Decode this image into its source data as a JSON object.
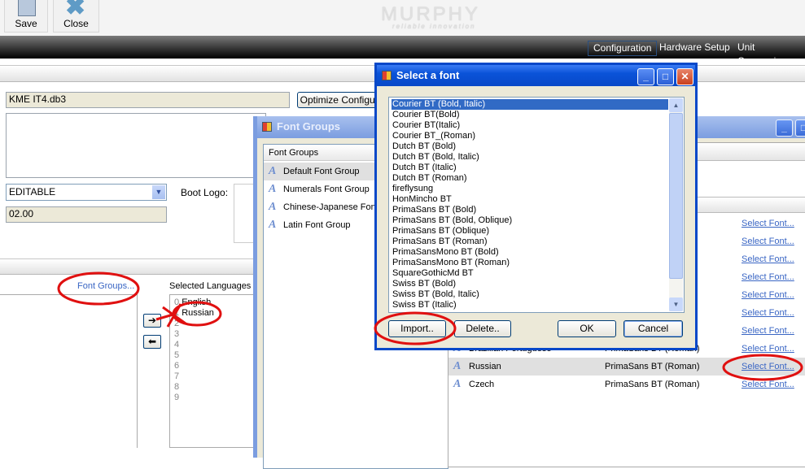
{
  "toolbar": {
    "save_label": "Save",
    "close_label": "Close",
    "logo_text": "MURPHY",
    "logo_tagline": "reliable innovation"
  },
  "nav": {
    "tabs": [
      {
        "label": "Configuration",
        "active": true
      },
      {
        "label": "Hardware Setup"
      },
      {
        "label": "Unit Conversion"
      }
    ]
  },
  "form": {
    "filename": "KME IT4.db3",
    "optimize_label": "Optimize Configura",
    "mode_value": "EDITABLE",
    "version_value": "02.00",
    "boot_logo_label": "Boot Logo:"
  },
  "languages": {
    "font_groups_link": "Font Groups...",
    "selected_label": "Selected Languages",
    "items": [
      {
        "index": "0",
        "name": "English"
      },
      {
        "index": "1",
        "name": "Russian"
      },
      {
        "index": "2",
        "name": ""
      },
      {
        "index": "3",
        "name": ""
      },
      {
        "index": "4",
        "name": ""
      },
      {
        "index": "5",
        "name": ""
      },
      {
        "index": "6",
        "name": ""
      },
      {
        "index": "7",
        "name": ""
      },
      {
        "index": "8",
        "name": ""
      },
      {
        "index": "9",
        "name": ""
      }
    ],
    "add_icon": "arrow-right-icon",
    "remove_icon": "arrow-left-icon"
  },
  "font_groups_window": {
    "title": "Font Groups",
    "list_header": "Font Groups",
    "groups": [
      "Default Font Group",
      "Numerals Font Group",
      "Chinese-Japanese Font",
      "Latin Font Group"
    ],
    "selected_group": "Default Font Group",
    "rows": [
      {
        "language": "",
        "font": ""
      },
      {
        "language": "",
        "font": ""
      },
      {
        "language": "",
        "font": ""
      },
      {
        "language": "",
        "font": ""
      },
      {
        "language": "",
        "font": ""
      },
      {
        "language": "",
        "font": ""
      },
      {
        "language": "",
        "font": ""
      },
      {
        "language": "Brazilian Portuguese",
        "font": "PrimaSans BT (Roman)"
      },
      {
        "language": "Russian",
        "font": "PrimaSans BT (Roman)",
        "selected": true
      },
      {
        "language": "Czech",
        "font": "PrimaSans BT (Roman)"
      }
    ],
    "select_font_label": "Select Font..."
  },
  "select_font_dialog": {
    "title": "Select a font",
    "fonts": [
      "Courier BT (Bold, Italic)",
      "Courier BT(Bold)",
      "Courier BT(Italic)",
      "Courier BT_(Roman)",
      "Dutch BT (Bold)",
      "Dutch BT (Bold, Italic)",
      "Dutch BT (Italic)",
      "Dutch BT (Roman)",
      "fireflysung",
      "HonMincho BT",
      "PrimaSans BT (Bold)",
      "PrimaSans BT (Bold, Oblique)",
      "PrimaSans BT (Oblique)",
      "PrimaSans BT (Roman)",
      "PrimaSansMono BT (Bold)",
      "PrimaSansMono BT (Roman)",
      "SquareGothicMd BT",
      "Swiss BT (Bold)",
      "Swiss BT (Bold, Italic)",
      "Swiss BT (Italic)"
    ],
    "selected_font": "Courier BT (Bold, Italic)",
    "import_label": "Import..",
    "delete_label": "Delete..",
    "ok_label": "OK",
    "cancel_label": "Cancel"
  },
  "colors": {
    "annotation": "#e01010",
    "selection": "#316ac5",
    "title_bar": "#0a53d8",
    "link": "#3a66c4"
  }
}
